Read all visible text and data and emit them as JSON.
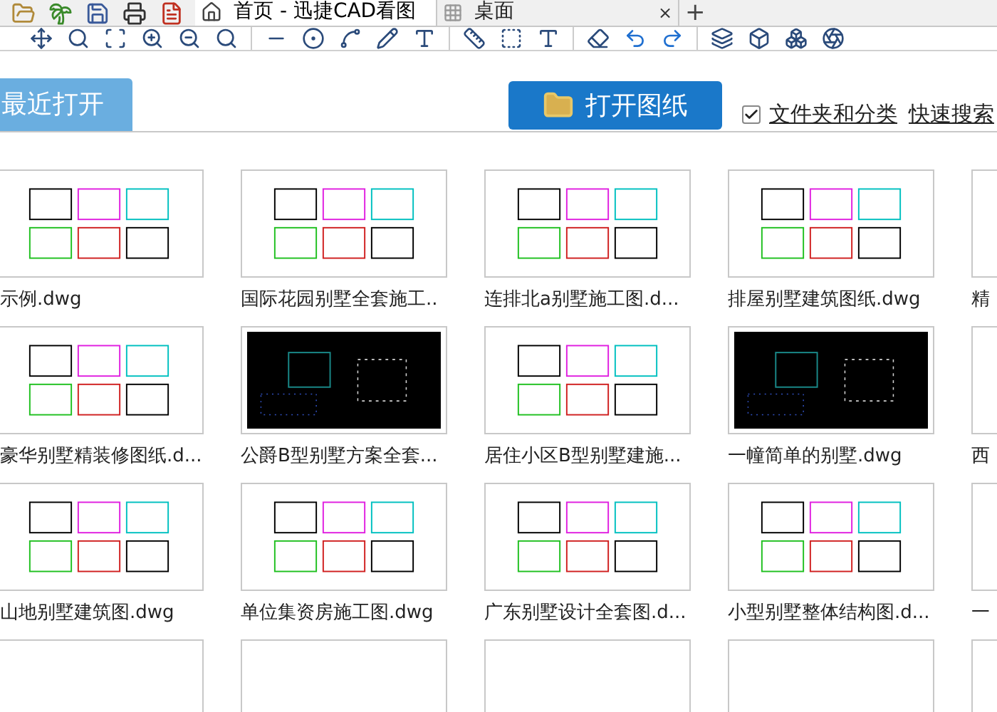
{
  "tabs": [
    {
      "label": "首页 - 迅捷CAD看图",
      "selected": true,
      "kind": "home"
    },
    {
      "label": "桌面",
      "selected": false,
      "kind": "grid",
      "close": "×"
    }
  ],
  "new_tab": "+",
  "open_button": "打开图纸",
  "folder_option": {
    "label": "文件夹和分类",
    "checked": true
  },
  "quick_search": "快速搜索",
  "section_tab": "最近打开",
  "files": [
    {
      "label": "示例.dwg",
      "kind": "light"
    },
    {
      "label": "国际花园别墅全套施工..",
      "kind": "light"
    },
    {
      "label": "连排北a别墅施工图.d...",
      "kind": "light"
    },
    {
      "label": "排屋别墅建筑图纸.dwg",
      "kind": "light"
    },
    {
      "label": "精",
      "kind": "partial"
    },
    {
      "label": "豪华别墅精装修图纸.d...",
      "kind": "light"
    },
    {
      "label": "公爵B型别墅方案全套...",
      "kind": "dark"
    },
    {
      "label": "居住小区B型别墅建施...",
      "kind": "light"
    },
    {
      "label": "一幢简单的别墅.dwg",
      "kind": "dark"
    },
    {
      "label": "西",
      "kind": "partial"
    },
    {
      "label": "山地别墅建筑图.dwg",
      "kind": "light"
    },
    {
      "label": "单位集资房施工图.dwg",
      "kind": "light"
    },
    {
      "label": "广东别墅设计全套图.d...",
      "kind": "light"
    },
    {
      "label": "小型别墅整体结构图.d...",
      "kind": "light"
    },
    {
      "label": "一",
      "kind": "partial"
    },
    {
      "kind": "partial"
    },
    {
      "kind": "partial"
    },
    {
      "kind": "partial"
    },
    {
      "kind": "partial"
    },
    {
      "kind": "partial"
    }
  ]
}
